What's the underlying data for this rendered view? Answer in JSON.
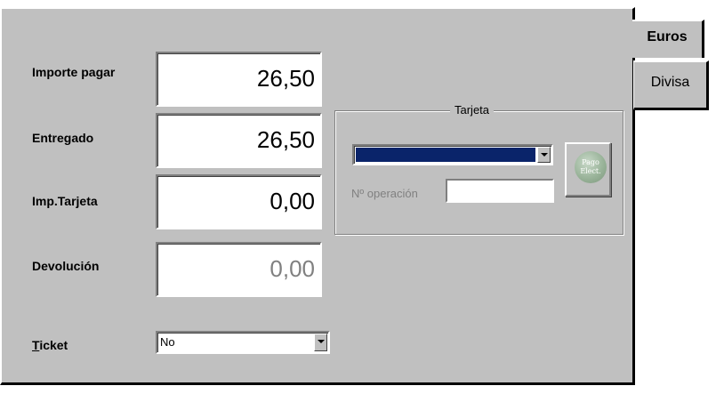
{
  "form": {
    "importe_label": "Importe pagar",
    "importe_value": "26,50",
    "entregado_label": "Entregado",
    "entregado_value": "26,50",
    "imp_tarjeta_label": "Imp.Tarjeta",
    "imp_tarjeta_value": "0,00",
    "devolucion_label": "Devolución",
    "devolucion_value": "0,00",
    "ticket_label_underlined": "T",
    "ticket_label_rest": "icket",
    "ticket_value": "No"
  },
  "tarjeta": {
    "title": "Tarjeta",
    "card_select_value": "",
    "card_select_color": "#0a246a",
    "operacion_label": "Nº operación",
    "operacion_value": "",
    "pago_button_line1": "Pago",
    "pago_button_line2": "Elect."
  },
  "tabs": [
    {
      "label": "Euros",
      "active": true
    },
    {
      "label": "Divisa",
      "active": false
    }
  ],
  "colors": {
    "panel": "#c0c0c0",
    "field_bg": "#ffffff",
    "disabled_text": "#808080",
    "selection": "#0a246a"
  }
}
